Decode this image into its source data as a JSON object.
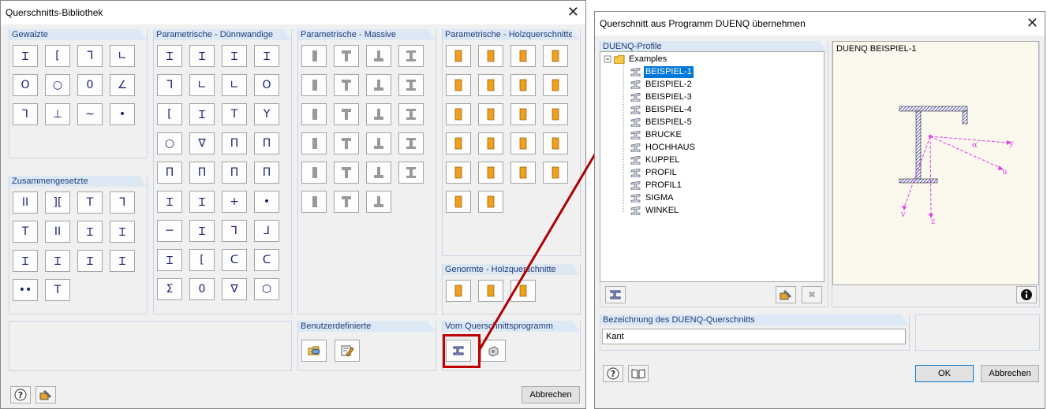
{
  "left_window": {
    "title": "Querschnitts-Bibliothek",
    "sections": {
      "gewalzte": "Gewalzte",
      "duennwandige": "Parametrische - Dünnwandige",
      "massive": "Parametrische - Massive",
      "holz": "Parametrische - Holzquerschnitte",
      "zusammengesetzte": "Zusammengesetzte",
      "genormte_holz": "Genormte - Holzquerschnitte",
      "benutzerdefinierte": "Benutzerdefinierte",
      "querschnittsprogramm": "Vom Querschnittsprogramm"
    },
    "gewalzte_icons": [
      "Ɪ",
      "[",
      "ᒣ",
      "∟",
      "O",
      "○",
      "0",
      "∠",
      "⅂",
      "⊥",
      "~",
      "•"
    ],
    "duenn_icons": [
      "Ɪ",
      "Ɪ",
      "Ɪ",
      "Ɪ",
      "ᒣ",
      "∟",
      "∟",
      "O",
      "[",
      "Ɪ",
      "T",
      "Y",
      "○",
      "∇",
      "Π",
      "Π",
      "Π",
      "Π",
      "Π",
      "Π",
      "Ɪ",
      "Ɪ",
      "+",
      "•",
      "─",
      "Ɪ",
      "⅂",
      "⅃",
      "Ɪ",
      "[",
      "ᑕ",
      "ᑕ",
      "Σ",
      "0",
      "∇",
      "⬡"
    ],
    "zus_icons": [
      "II",
      "][",
      "T",
      "ᒣ",
      "T",
      "II",
      "Ɪ",
      "Ɪ",
      "Ɪ",
      "Ɪ",
      "Ɪ",
      "Ɪ",
      "••",
      "T"
    ],
    "cancel": "Abbrechen"
  },
  "right_window": {
    "title": "Querschnitt aus Programm DUENQ übernehmen",
    "profiles_header": "DUENQ-Profile",
    "tree_root": "Examples",
    "tree_items": [
      "BEISPIEL-1",
      "BEISPIEL-2",
      "BEISPIEL-3",
      "BEISPIEL-4",
      "BEISPIEL-5",
      "BRUCKE",
      "HOCHHAUS",
      "KUPPEL",
      "PROFIL",
      "PROFIL1",
      "SIGMA",
      "WINKEL"
    ],
    "preview_title": "DUENQ BEISPIEL-1",
    "axis": {
      "y": "y",
      "u": "u",
      "v": "v",
      "z": "z",
      "alpha": "α"
    },
    "designation_header": "Bezeichnung des DUENQ-Querschnitts",
    "designation_value": "Kant",
    "ok": "OK",
    "cancel": "Abbrechen"
  },
  "colors": {
    "accent": "#0078d7",
    "highlight": "#c00000",
    "steel": "#1a2470",
    "wood": "#e8a126",
    "section_header": "#dde8f5"
  }
}
